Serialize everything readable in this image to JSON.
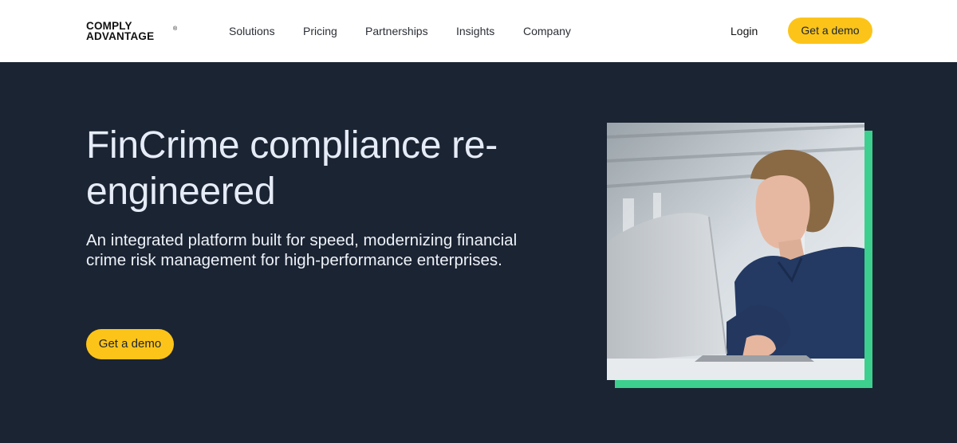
{
  "brand": {
    "line1": "COMPLY",
    "line2": "ADVANTAGE",
    "reg_mark": "®"
  },
  "nav": {
    "items": [
      {
        "label": "Solutions"
      },
      {
        "label": "Pricing"
      },
      {
        "label": "Partnerships"
      },
      {
        "label": "Insights"
      },
      {
        "label": "Company"
      }
    ],
    "login": "Login",
    "cta": "Get a demo"
  },
  "hero": {
    "title": "FinCrime compliance re-engineered",
    "subtitle": "An integrated platform built for speed, modernizing financial crime risk management for high-performance enterprises.",
    "cta": "Get a demo"
  },
  "colors": {
    "background": "#1b2433",
    "accent_yellow": "#fcc419",
    "accent_green": "#3ccf8e",
    "header_bg": "#ffffff"
  },
  "image": {
    "icon": "photo-woman-laptop"
  }
}
